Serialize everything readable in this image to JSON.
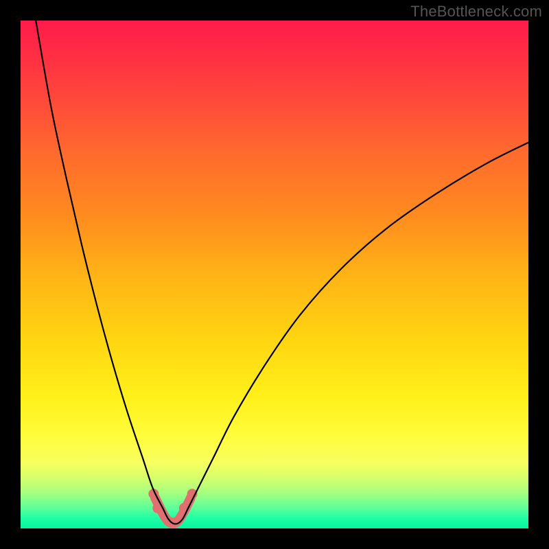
{
  "watermark": "TheBottleneck.com",
  "chart_data": {
    "type": "line",
    "title": "",
    "xlabel": "",
    "ylabel": "",
    "xlim": [
      0,
      100
    ],
    "ylim": [
      0,
      100
    ],
    "grid": false,
    "series": [
      {
        "name": "bottleneck-curve",
        "x": [
          3,
          6,
          9,
          12,
          15,
          18,
          21,
          24,
          26,
          28,
          29,
          30,
          31,
          32,
          33,
          35,
          38,
          42,
          48,
          55,
          63,
          72,
          82,
          92,
          100
        ],
        "y": [
          100,
          83,
          69,
          56,
          44,
          33,
          23,
          14,
          8,
          4,
          2,
          1,
          1,
          2,
          4,
          8,
          14,
          22,
          32,
          42,
          51,
          59,
          66,
          72,
          76
        ]
      }
    ],
    "marker_region": {
      "name": "optimal-zone",
      "x": [
        26.5,
        28,
        29,
        30,
        31,
        32,
        33.5
      ],
      "y": [
        6,
        3,
        1.5,
        1,
        1.5,
        3,
        6
      ]
    },
    "marker_dots": {
      "x": [
        26.2,
        27.0,
        29.5,
        30.5,
        32.2,
        33.8
      ],
      "y": [
        6.8,
        4.0,
        1.2,
        1.2,
        4.0,
        6.8
      ]
    }
  }
}
